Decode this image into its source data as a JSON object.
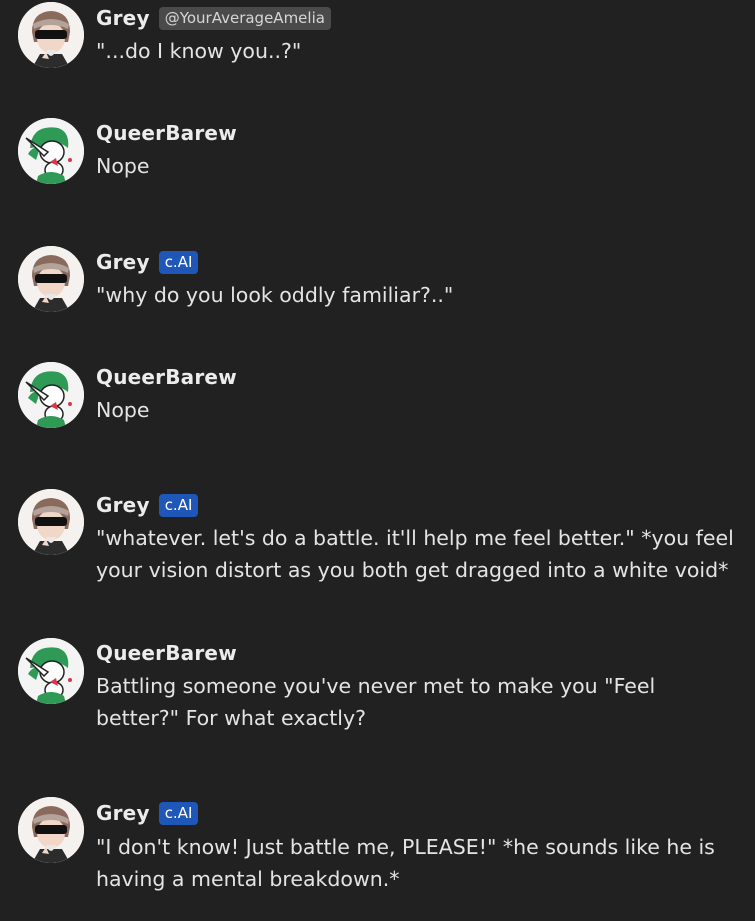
{
  "messages": [
    {
      "name": "Grey",
      "badge": "@YourAverageAmelia",
      "badge_type": "user",
      "avatar": "grey-avatar",
      "text": "\"...do I know you..?\""
    },
    {
      "name": "QueerBarew",
      "badge": "",
      "badge_type": "none",
      "avatar": "gardevoir-avatar",
      "text": "Nope"
    },
    {
      "name": "Grey",
      "badge": "c.AI",
      "badge_type": "ai",
      "avatar": "grey-avatar",
      "text": "\"why do you look oddly familiar?..\""
    },
    {
      "name": "QueerBarew",
      "badge": "",
      "badge_type": "none",
      "avatar": "gardevoir-avatar",
      "text": "Nope"
    },
    {
      "name": "Grey",
      "badge": "c.AI",
      "badge_type": "ai",
      "avatar": "grey-avatar",
      "text": "\"whatever. let's do a battle. it'll help me feel better.\" *you feel your vision distort as you both get dragged into a white void*"
    },
    {
      "name": "QueerBarew",
      "badge": "",
      "badge_type": "none",
      "avatar": "gardevoir-avatar",
      "text": "Battling someone you've never met to make you \"Feel better?\" For what exactly?"
    },
    {
      "name": "Grey",
      "badge": "c.AI",
      "badge_type": "ai",
      "avatar": "grey-avatar",
      "text": "\"I don't know! Just battle me, PLEASE!\" *he sounds like he is having a mental breakdown.*"
    }
  ],
  "colors": {
    "background": "#212121",
    "ai_badge": "#1f57b8",
    "user_badge": "#4a4a4a"
  }
}
